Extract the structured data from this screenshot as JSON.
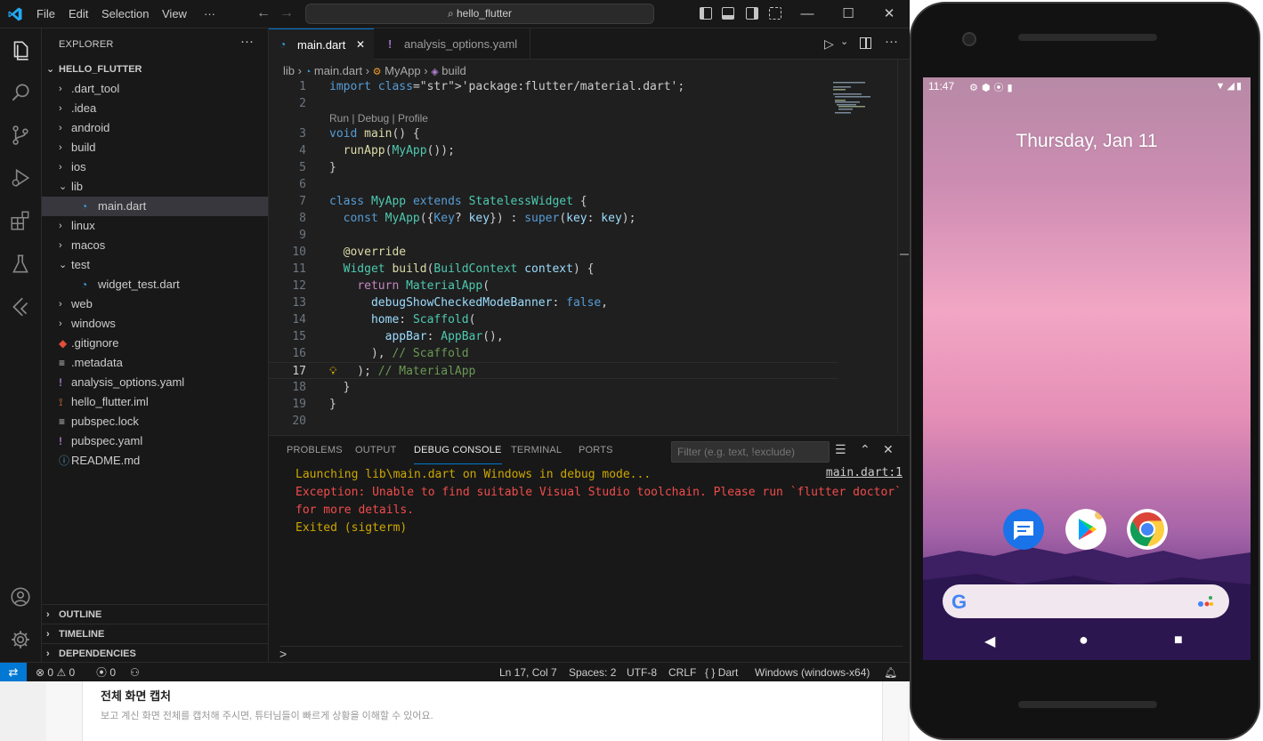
{
  "vscode": {
    "menu": [
      "File",
      "Edit",
      "Selection",
      "View",
      "···"
    ],
    "search": "hello_flutter",
    "window_controls": [
      "—",
      "☐",
      "✕"
    ],
    "explorer": {
      "title": "EXPLORER",
      "more": "···",
      "root": "HELLO_FLUTTER",
      "items": [
        {
          "label": ".dart_tool",
          "type": "folder",
          "expanded": false,
          "depth": 1
        },
        {
          "label": ".idea",
          "type": "folder",
          "expanded": false,
          "depth": 1
        },
        {
          "label": "android",
          "type": "folder",
          "expanded": false,
          "depth": 1
        },
        {
          "label": "build",
          "type": "folder",
          "expanded": false,
          "depth": 1
        },
        {
          "label": "ios",
          "type": "folder",
          "expanded": false,
          "depth": 1
        },
        {
          "label": "lib",
          "type": "folder",
          "expanded": true,
          "depth": 1
        },
        {
          "label": "main.dart",
          "type": "dart",
          "depth": 2,
          "selected": true
        },
        {
          "label": "linux",
          "type": "folder",
          "expanded": false,
          "depth": 1
        },
        {
          "label": "macos",
          "type": "folder",
          "expanded": false,
          "depth": 1
        },
        {
          "label": "test",
          "type": "folder",
          "expanded": true,
          "depth": 1
        },
        {
          "label": "widget_test.dart",
          "type": "dart",
          "depth": 2
        },
        {
          "label": "web",
          "type": "folder",
          "expanded": false,
          "depth": 1
        },
        {
          "label": "windows",
          "type": "folder",
          "expanded": false,
          "depth": 1
        },
        {
          "label": ".gitignore",
          "type": "git",
          "depth": 1
        },
        {
          "label": ".metadata",
          "type": "text",
          "depth": 1
        },
        {
          "label": "analysis_options.yaml",
          "type": "yaml",
          "depth": 1
        },
        {
          "label": "hello_flutter.iml",
          "type": "rss",
          "depth": 1
        },
        {
          "label": "pubspec.lock",
          "type": "text",
          "depth": 1
        },
        {
          "label": "pubspec.yaml",
          "type": "yaml",
          "depth": 1
        },
        {
          "label": "README.md",
          "type": "info",
          "depth": 1
        }
      ],
      "sections": [
        "OUTLINE",
        "TIMELINE",
        "DEPENDENCIES"
      ]
    },
    "tabs": [
      {
        "label": "main.dart",
        "active": true,
        "close": "✕"
      },
      {
        "label": "analysis_options.yaml",
        "active": false
      }
    ],
    "breadcrumb": [
      "lib",
      "main.dart",
      "MyApp",
      "build"
    ],
    "code_lens": "Run | Debug | Profile",
    "code": [
      {
        "n": "1",
        "text": "import 'package:flutter/material.dart';"
      },
      {
        "n": "2",
        "text": ""
      },
      {
        "n": "3",
        "text": "void main() {"
      },
      {
        "n": "4",
        "text": "  runApp(MyApp());"
      },
      {
        "n": "5",
        "text": "}"
      },
      {
        "n": "6",
        "text": ""
      },
      {
        "n": "7",
        "text": "class MyApp extends StatelessWidget {"
      },
      {
        "n": "8",
        "text": "  const MyApp({Key? key}) : super(key: key);"
      },
      {
        "n": "9",
        "text": ""
      },
      {
        "n": "10",
        "text": "  @override"
      },
      {
        "n": "11",
        "text": "  Widget build(BuildContext context) {"
      },
      {
        "n": "12",
        "text": "    return MaterialApp("
      },
      {
        "n": "13",
        "text": "      debugShowCheckedModeBanner: false,"
      },
      {
        "n": "14",
        "text": "      home: Scaffold("
      },
      {
        "n": "15",
        "text": "        appBar: AppBar(),"
      },
      {
        "n": "16",
        "text": "      ), // Scaffold"
      },
      {
        "n": "17",
        "text": "    ); // MaterialApp"
      },
      {
        "n": "18",
        "text": "  }"
      },
      {
        "n": "19",
        "text": "}"
      },
      {
        "n": "20",
        "text": ""
      }
    ],
    "panel": {
      "tabs": [
        "PROBLEMS",
        "OUTPUT",
        "DEBUG CONSOLE",
        "TERMINAL",
        "PORTS"
      ],
      "active_tab": "DEBUG CONSOLE",
      "filter_placeholder": "Filter (e.g. text, !exclude)",
      "console": [
        {
          "text": "Launching lib\\main.dart on Windows in debug mode...",
          "level": "info"
        },
        {
          "text": "Exception: Unable to find suitable Visual Studio toolchain. Please run `flutter doctor`",
          "level": "error"
        },
        {
          "text": "for more details.",
          "level": "error"
        },
        {
          "text": "Exited (sigterm)",
          "level": "info"
        }
      ],
      "source_link": "main.dart:1",
      "prompt": ">"
    },
    "status": {
      "errors": "0",
      "warnings": "0",
      "ports": "0",
      "cursor": "Ln 17, Col 7",
      "spaces": "Spaces: 2",
      "encoding": "UTF-8",
      "eol": "CRLF",
      "language": "Dart",
      "device": "Windows (windows-x64)"
    }
  },
  "behind_page": {
    "title": "전체 화면 캡처",
    "desc": "보고 계신 화면 전체를 캡처해 주시면, 튜터님들이 빠르게 상황을 이해할 수 있어요."
  },
  "android": {
    "time": "11:47",
    "date": "Thursday, Jan 11",
    "dock_apps": [
      "messages-icon",
      "play-store-icon",
      "chrome-icon"
    ]
  },
  "colors": {
    "accent": "#0078d4",
    "editor_bg": "#1f1f1f",
    "error": "#f14c4c",
    "warning": "#cca700"
  }
}
